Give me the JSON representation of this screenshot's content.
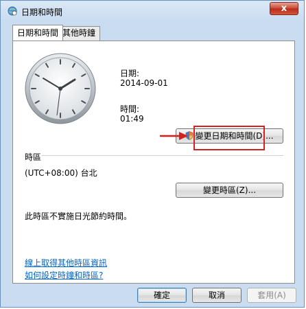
{
  "window": {
    "title": "日期和時間",
    "close_glyph": "x"
  },
  "tabs": [
    {
      "label": "日期和時間",
      "active": true
    },
    {
      "label": "其他時鐘",
      "active": false
    }
  ],
  "clock": {
    "displayed_time": "01:49"
  },
  "date_section": {
    "date_label": "日期:",
    "date_value": "2014-09-01",
    "time_label": "時間:",
    "time_value": "01:49",
    "change_button": "變更日期和時間(D)..."
  },
  "timezone_section": {
    "header": "時區",
    "value": "(UTC+08:00) 台北",
    "change_button": "變更時區(Z)...",
    "dst_note": "此時區不實施日光節約時間。"
  },
  "links": [
    "線上取得其他時區資訊",
    "如何設定時鐘和時區?"
  ],
  "footer": {
    "ok": "確定",
    "cancel": "取消",
    "apply": "套用(A)"
  },
  "colors": {
    "annotation_red": "#d62020",
    "link_blue": "#0066cc"
  },
  "icons": {
    "title": "clock-globe-icon",
    "uac": "uac-shield-icon",
    "annotation": "red-arrow-icon"
  }
}
